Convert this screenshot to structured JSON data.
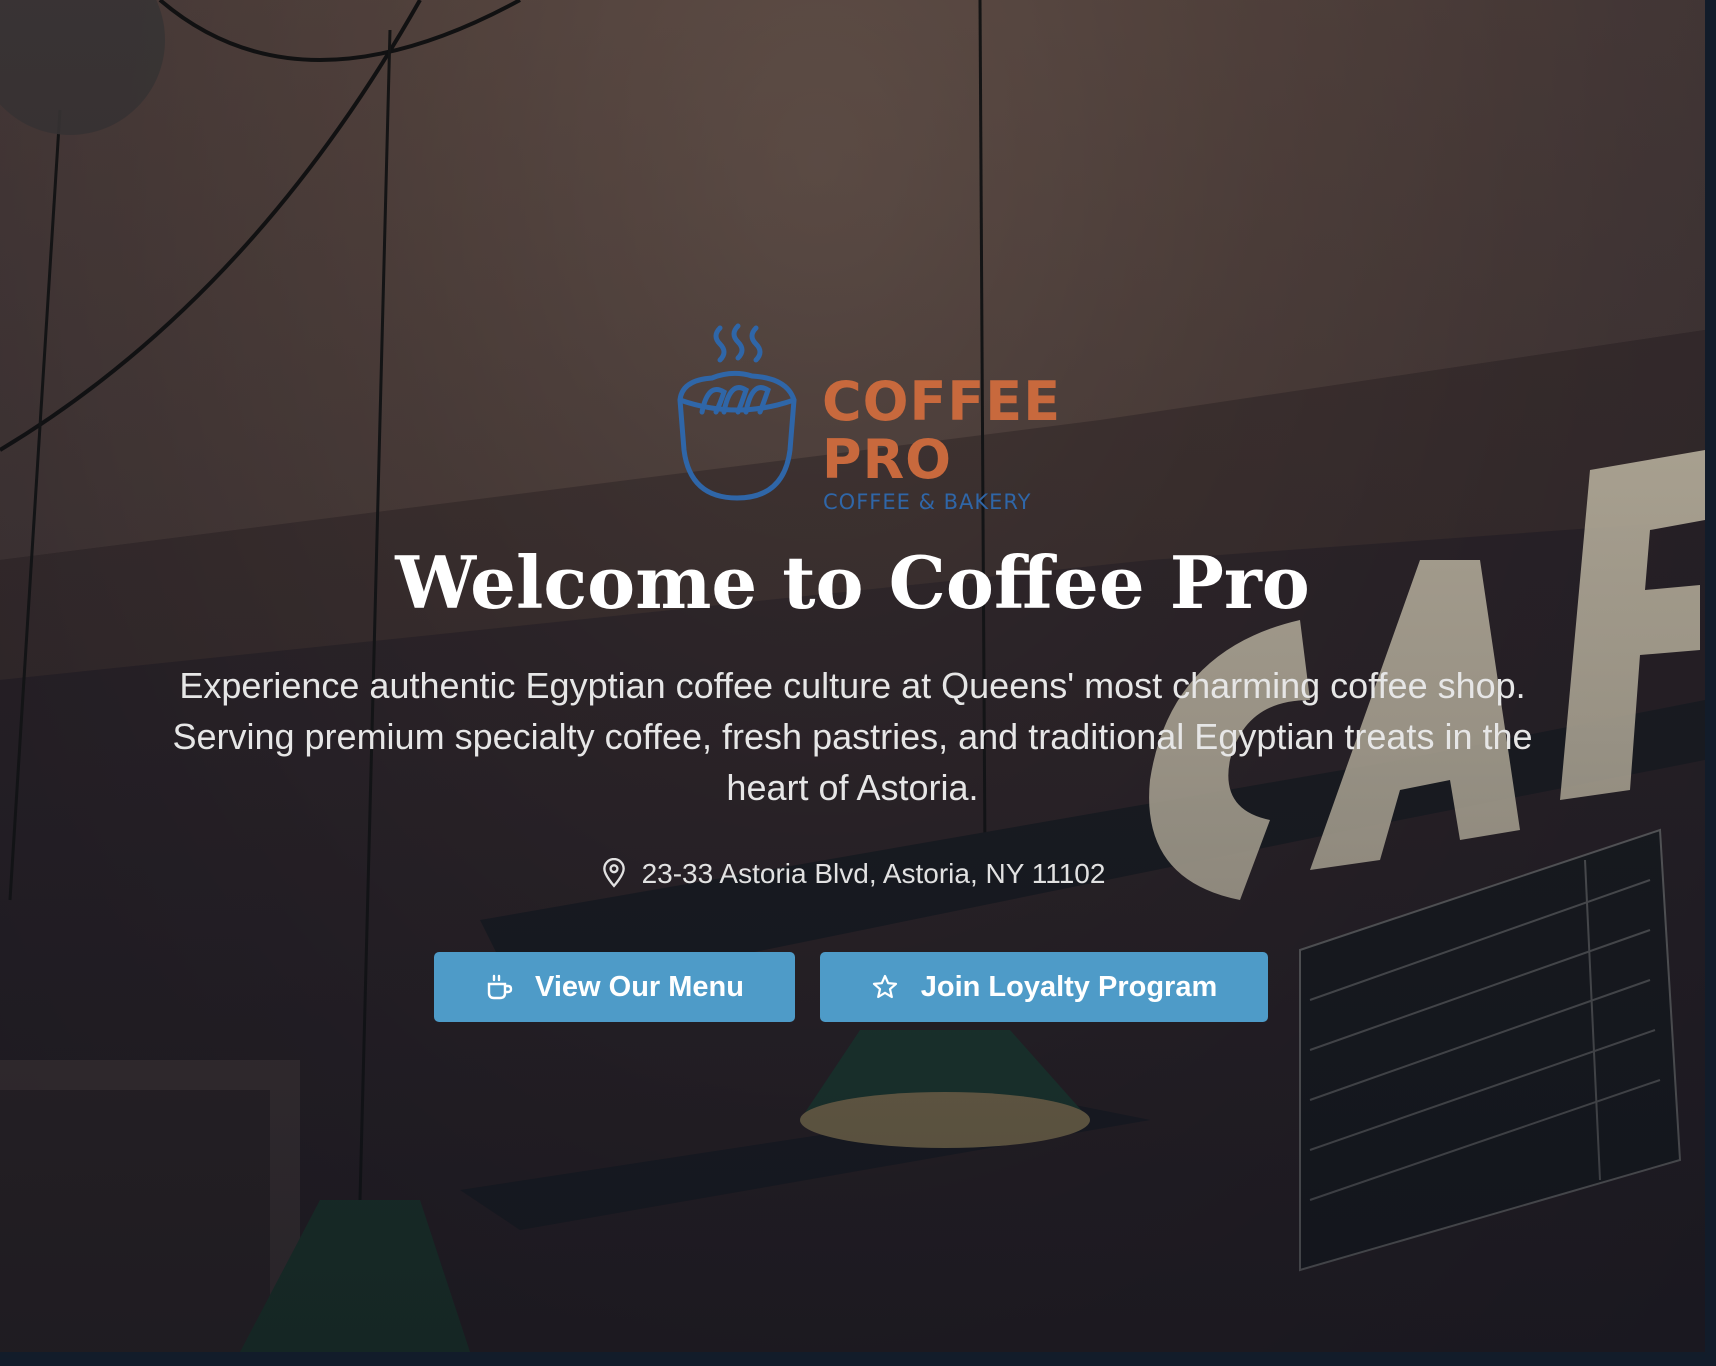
{
  "brand": {
    "logo_word_1": "COFFEE",
    "logo_word_2": "PRO",
    "logo_tagline": "COFFEE & BAKERY",
    "logo_icon": "coffee-cup-steam-icon",
    "primary_color": "#c8693d",
    "secondary_color": "#2f66a8"
  },
  "hero": {
    "title": "Welcome to Coffee Pro",
    "description": "Experience authentic Egyptian coffee culture at Queens' most charming coffee shop. Serving premium specialty coffee, fresh pastries, and traditional Egyptian treats in the heart of Astoria.",
    "address": "23-33 Astoria Blvd, Astoria, NY 11102",
    "address_icon": "map-pin-icon"
  },
  "actions": {
    "menu_button": {
      "label": "View Our Menu",
      "icon": "coffee-cup-icon"
    },
    "loyalty_button": {
      "label": "Join Loyalty Program",
      "icon": "star-icon"
    },
    "button_color": "#4e9bc8"
  }
}
